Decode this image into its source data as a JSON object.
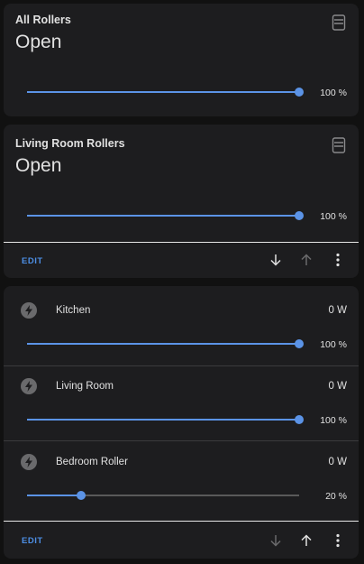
{
  "cards": [
    {
      "title": "All Rollers",
      "state": "Open",
      "percent": 100,
      "percent_label": "100 %",
      "icon": "roller-shade-icon"
    },
    {
      "title": "Living Room Rollers",
      "state": "Open",
      "percent": 100,
      "percent_label": "100 %",
      "icon": "roller-shade-icon"
    }
  ],
  "card2_actions": {
    "edit_label": "EDIT",
    "move_down_icon": "arrow-down-icon",
    "move_up_icon": "arrow-up-icon",
    "menu_icon": "more-vert-icon",
    "down_enabled": true,
    "up_enabled": false
  },
  "entities": [
    {
      "name": "Kitchen",
      "power": "0 W",
      "percent": 100,
      "percent_label": "100 %",
      "icon": "flash-icon"
    },
    {
      "name": "Living Room",
      "power": "0 W",
      "percent": 100,
      "percent_label": "100 %",
      "icon": "flash-icon"
    },
    {
      "name": "Bedroom Roller",
      "power": "0 W",
      "percent": 20,
      "percent_label": "20 %",
      "icon": "flash-icon"
    }
  ],
  "card3_actions": {
    "edit_label": "EDIT",
    "move_down_icon": "arrow-down-icon",
    "move_up_icon": "arrow-up-icon",
    "menu_icon": "more-vert-icon",
    "down_enabled": false,
    "up_enabled": true
  },
  "colors": {
    "accent": "#5b93e6",
    "card_bg": "#1d1d1f",
    "page_bg": "#111111"
  }
}
